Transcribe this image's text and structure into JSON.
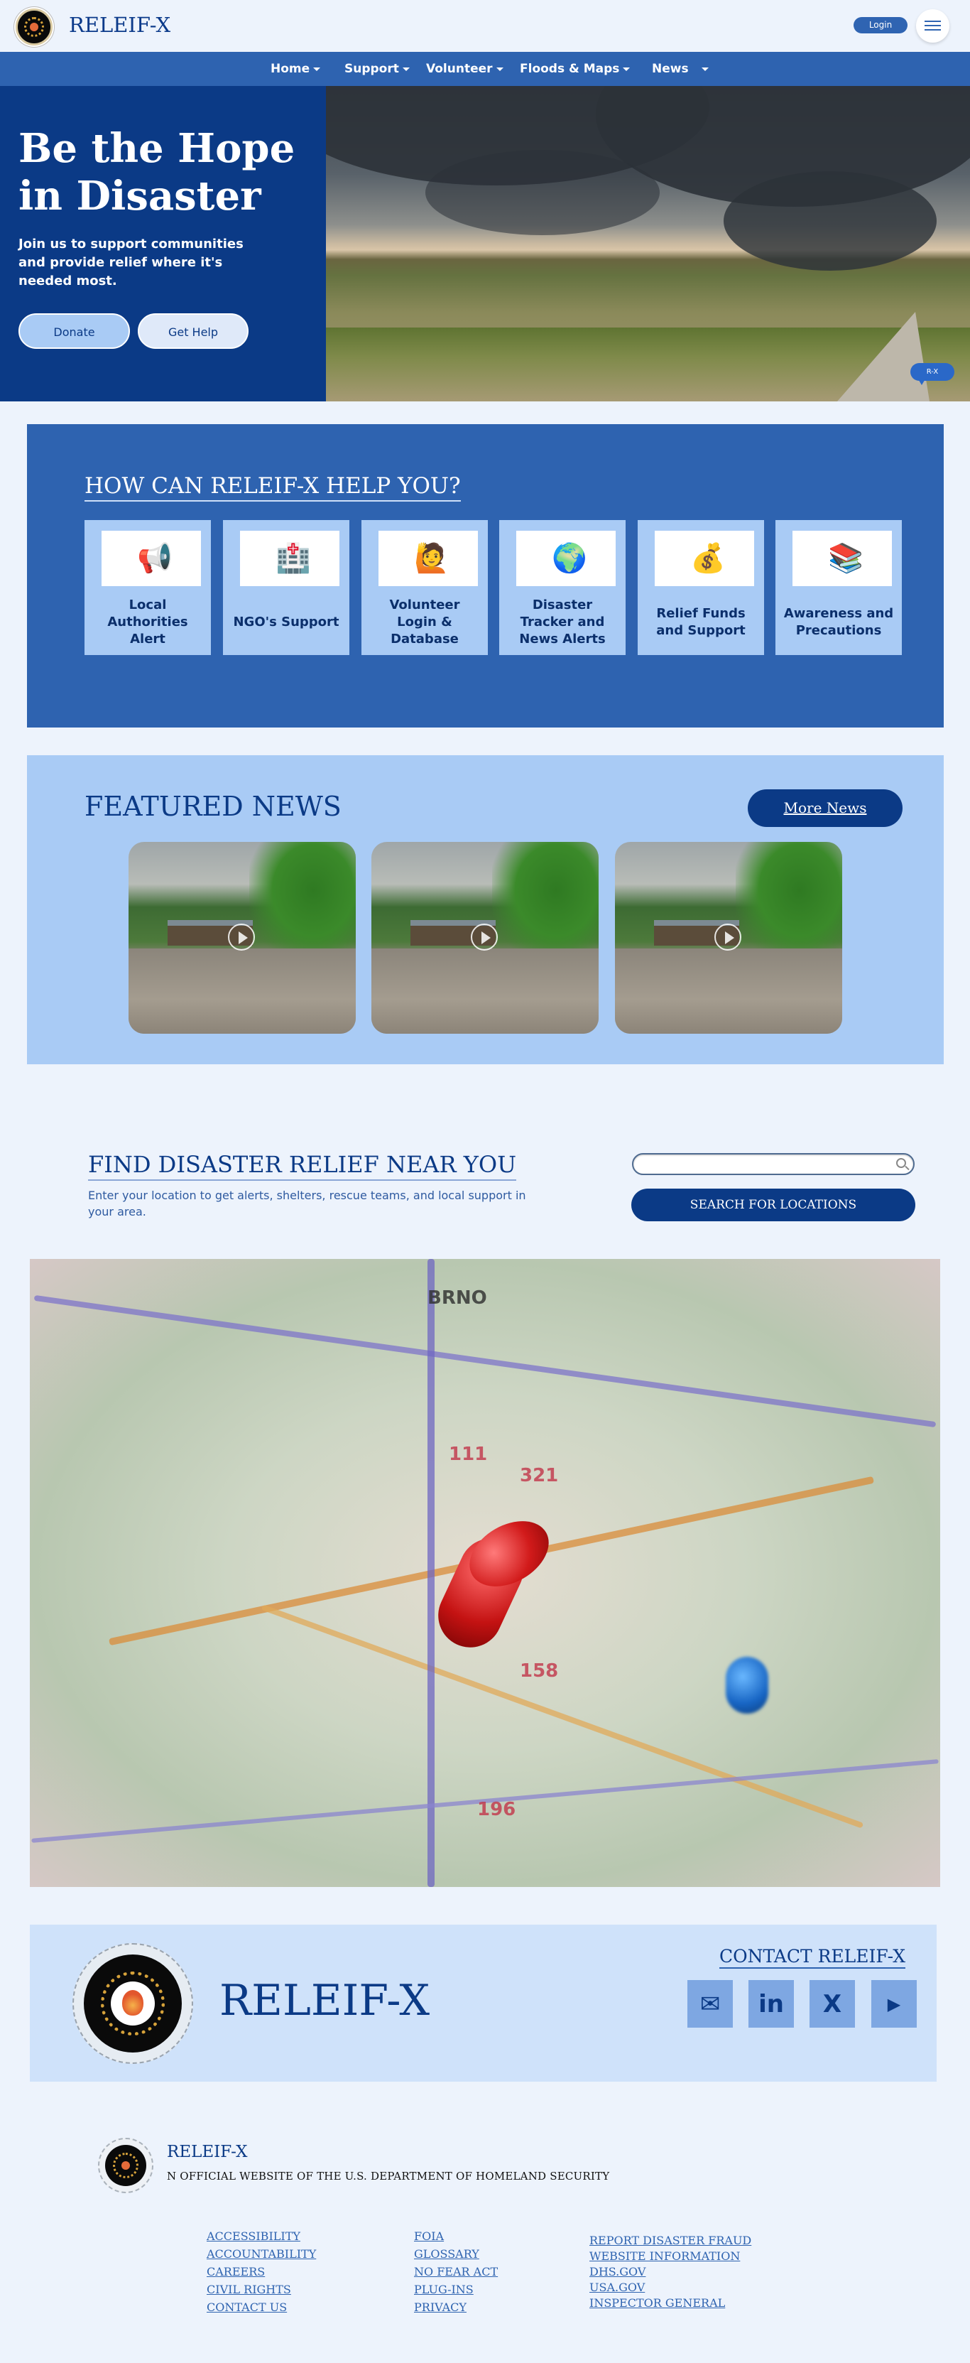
{
  "header": {
    "brand": "RELEIF-X",
    "login_label": "Login"
  },
  "nav": {
    "items": [
      {
        "label": "Home"
      },
      {
        "label": "Support"
      },
      {
        "label": "Volunteer"
      },
      {
        "label": "Floods & Maps"
      },
      {
        "label": "News"
      }
    ]
  },
  "hero": {
    "title": "Be the Hope in Disaster",
    "subtitle": "Join us to support communities and provide relief where it's needed most.",
    "donate_label": "Donate",
    "get_help_label": "Get Help",
    "chat_label": "R-X"
  },
  "help": {
    "title": "HOW CAN RELEIF-X HELP YOU?",
    "cards": [
      {
        "label": "Local Authorities Alert",
        "icon": "megaphone-icon",
        "glyph": "📢"
      },
      {
        "label": "NGO's Support",
        "icon": "hospital-icon",
        "glyph": "🏥"
      },
      {
        "label": "Volunteer Login & Database",
        "icon": "person-raising-hand-icon",
        "glyph": "🙋"
      },
      {
        "label": "Disaster Tracker and News Alerts",
        "icon": "globe-icon",
        "glyph": "🌍"
      },
      {
        "label": "Relief Funds and Support",
        "icon": "money-bag-icon",
        "glyph": "💰"
      },
      {
        "label": "Awareness and Precautions",
        "icon": "books-icon",
        "glyph": "📚"
      }
    ]
  },
  "news": {
    "title": "FEATURED NEWS",
    "more_label": "More News"
  },
  "find": {
    "title": "FIND DISASTER RELIEF NEAR YOU",
    "subtitle": "Enter your location to get alerts, shelters, rescue teams, and local support in your area.",
    "search_placeholder": "",
    "search_button": "SEARCH FOR LOCATIONS"
  },
  "map": {
    "labels": [
      "BRNO",
      "111",
      "321",
      "196",
      "158"
    ]
  },
  "contact": {
    "brand": "RELEIF-X",
    "title": "CONTACT RELEIF-X",
    "socials": [
      {
        "name": "mail-icon",
        "glyph": "✉"
      },
      {
        "name": "linkedin-icon",
        "glyph": "in"
      },
      {
        "name": "x-icon",
        "glyph": "X"
      },
      {
        "name": "youtube-icon",
        "glyph": "▶"
      }
    ]
  },
  "footer": {
    "brand": "RELEIF-X",
    "official": "N OFFICIAL WEBSITE OF THE U.S. DEPARTMENT OF HOMELAND SECURITY",
    "col1": [
      "ACCESSIBILITY",
      "ACCOUNTABILITY",
      "CAREERS",
      "CIVIL RIGHTS",
      "CONTACT US"
    ],
    "col2": [
      "FOIA",
      "GLOSSARY",
      "NO FEAR ACT",
      "PLUG-INS",
      "PRIVACY"
    ],
    "col3": [
      "REPORT DISASTER FRAUD",
      "WEBSITE INFORMATION",
      "DHS.GOV",
      "USA.GOV",
      "INSPECTOR GENERAL"
    ]
  },
  "colors": {
    "primary": "#0b3a86",
    "accent": "#2e63b0",
    "light": "#a9cbf5",
    "background": "#edf3fc"
  }
}
